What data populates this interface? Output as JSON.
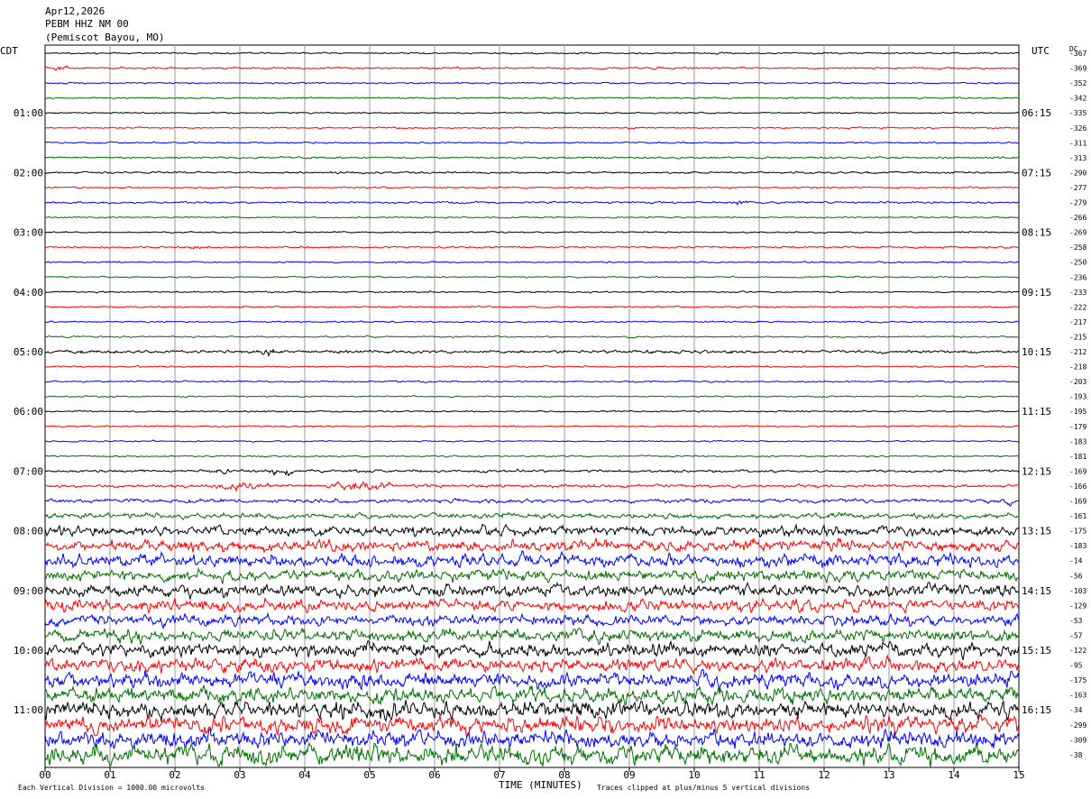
{
  "header": {
    "date": "Apr12,2026",
    "station": "PEBM HHZ NM 00",
    "location": "(Pemiscot Bayou, MO)"
  },
  "labels": {
    "left_tz": "CDT",
    "right_tz": "UTC",
    "dc": "DC"
  },
  "footer": {
    "scale_note": "Each Vertical Division = 1000.00 microvolts",
    "xlabel": "TIME (MINUTES)",
    "clip_note": "Traces clipped at plus/minus 5 vertical divisions"
  },
  "colors": {
    "cycle": [
      "#000000",
      "#ff0000",
      "#0000ff",
      "#007000"
    ],
    "grid": "#9a9a9a"
  },
  "chart_data": {
    "type": "helicorder",
    "xlabel": "TIME (MINUTES)",
    "xlim": [
      0,
      15
    ],
    "x_ticks": [
      "00",
      "01",
      "02",
      "03",
      "04",
      "05",
      "06",
      "07",
      "08",
      "09",
      "10",
      "11",
      "12",
      "13",
      "14",
      "15"
    ],
    "rows_per_hour": 4,
    "minutes_per_row": 15,
    "left_time_labels": [
      "01:00",
      "02:00",
      "03:00",
      "04:00",
      "05:00",
      "06:00",
      "07:00",
      "08:00",
      "09:00",
      "10:00",
      "11:00"
    ],
    "right_time_labels": [
      "06:15",
      "07:15",
      "08:15",
      "09:15",
      "10:15",
      "11:15",
      "12:15",
      "13:15",
      "14:15",
      "15:15",
      "16:15"
    ],
    "dc_offsets": [
      "-367",
      "-369",
      "-352",
      "-342",
      "-335",
      "-326",
      "-311",
      "-313",
      "-290",
      "-277",
      "-279",
      "-266",
      "-269",
      "-258",
      "-250",
      "-236",
      "-233",
      "-222",
      "-217",
      "-215",
      "-212",
      "-218",
      "-203",
      "-193",
      "-195",
      "-179",
      "-183",
      "-181",
      "-169",
      "-166",
      "-169",
      "-161",
      "-175",
      "-183",
      "-14",
      "-56",
      "-103",
      "-129",
      "-53",
      "-57",
      "-122",
      "-95",
      "-175",
      "-163",
      "-34",
      "-299",
      "-309",
      "-38"
    ],
    "amplitude_divisions": [
      0.2,
      0.25,
      0.2,
      0.2,
      0.2,
      0.2,
      0.2,
      0.25,
      0.25,
      0.2,
      0.25,
      0.2,
      0.2,
      0.25,
      0.2,
      0.2,
      0.2,
      0.2,
      0.2,
      0.2,
      0.4,
      0.2,
      0.2,
      0.2,
      0.2,
      0.2,
      0.2,
      0.2,
      0.35,
      0.4,
      0.5,
      0.7,
      1.3,
      1.5,
      1.7,
      1.5,
      1.6,
      1.6,
      1.4,
      1.6,
      1.8,
      1.8,
      2.0,
      2.0,
      2.2,
      2.2,
      2.2,
      2.6
    ],
    "events": [
      {
        "row": 1,
        "start_min": 0.1,
        "end_min": 0.4,
        "amp": 0.6
      },
      {
        "row": 10,
        "start_min": 10.6,
        "end_min": 10.9,
        "amp": 0.9
      },
      {
        "row": 13,
        "start_min": 2.1,
        "end_min": 2.5,
        "amp": 0.5
      },
      {
        "row": 20,
        "start_min": 3.3,
        "end_min": 3.6,
        "amp": 0.7
      },
      {
        "row": 28,
        "start_min": 2.4,
        "end_min": 2.9,
        "amp": 0.5
      },
      {
        "row": 28,
        "start_min": 3.4,
        "end_min": 3.9,
        "amp": 1.0
      },
      {
        "row": 29,
        "start_min": 2.5,
        "end_min": 3.6,
        "amp": 0.9
      },
      {
        "row": 29,
        "start_min": 4.3,
        "end_min": 5.4,
        "amp": 1.3
      },
      {
        "row": 30,
        "start_min": 14.8,
        "end_min": 15.0,
        "amp": 0.8
      }
    ]
  }
}
